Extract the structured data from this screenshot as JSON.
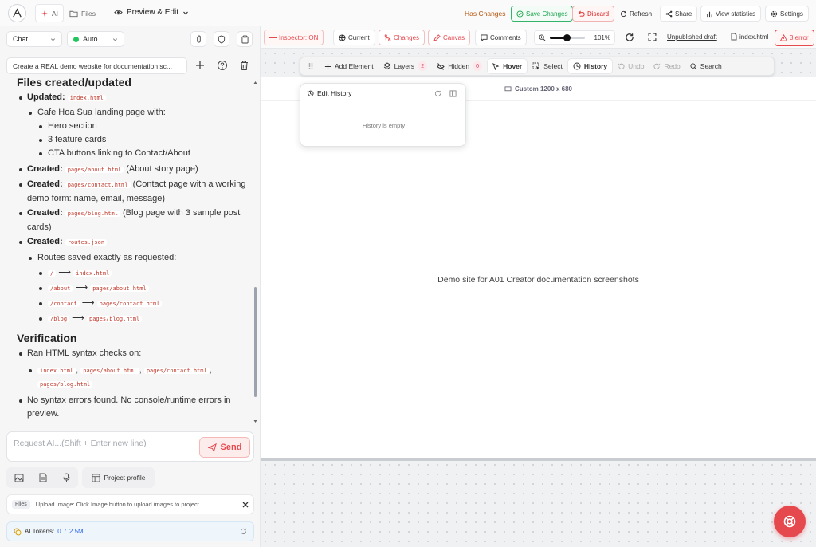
{
  "topbar": {
    "tabs": [
      {
        "label": "AI"
      },
      {
        "label": "Files"
      }
    ],
    "mode": "Preview & Edit",
    "status": "Has Changes",
    "save": "Save Changes",
    "discard": "Discard",
    "refresh": "Refresh",
    "share": "Share",
    "stats": "View statistics",
    "settings": "Settings"
  },
  "sidebar": {
    "mode_select": "Chat",
    "model_select": "Auto",
    "conversation_title": "Create a REAL demo website for documentation sc...",
    "message": {
      "h1": "Files created/updated",
      "updated_label": "Updated:",
      "updated_file": "index.html",
      "landing": "Cafe Hoa Sua landing page with:",
      "landing_items": [
        "Hero section",
        "3 feature cards",
        "CTA buttons linking to Contact/About"
      ],
      "created": [
        {
          "label": "Created:",
          "file": "pages/about.html",
          "desc": "(About story page)"
        },
        {
          "label": "Created:",
          "file": "pages/contact.html",
          "desc": "(Contact page with a working demo form: name, email, message)"
        },
        {
          "label": "Created:",
          "file": "pages/blog.html",
          "desc": "(Blog page with 3 sample post cards)"
        },
        {
          "label": "Created:",
          "file": "routes.json",
          "desc": ""
        }
      ],
      "routes_intro": "Routes saved exactly as requested:",
      "routes": [
        {
          "path": "/",
          "file": "index.html"
        },
        {
          "path": "/about",
          "file": "pages/about.html"
        },
        {
          "path": "/contact",
          "file": "pages/contact.html"
        },
        {
          "path": "/blog",
          "file": "pages/blog.html"
        }
      ],
      "arrow": "⟶",
      "h2": "Verification",
      "syntax": "Ran HTML syntax checks on:",
      "checked": [
        "index.html",
        "pages/about.html",
        "pages/contact.html",
        "pages/blog.html"
      ],
      "separator": ",",
      "result": "No syntax errors found. No console/runtime errors in preview."
    },
    "input_placeholder": "Request AI...(Shift + Enter new line)",
    "send": "Send",
    "project_profile": "Project profile",
    "files_tag": "Files",
    "upload_hint": "Upload Image: Click Image button to upload images to project.",
    "tokens_label": "AI Tokens:",
    "tokens_used": "0",
    "tokens_sep": "/",
    "tokens_total": "2.5M"
  },
  "canvas_toolbar": {
    "inspector": "Inspector: ON",
    "current": "Current",
    "changes": "Changes",
    "canvas": "Canvas",
    "comments": "Comments",
    "zoom": "101%",
    "zoom_value": 0.48,
    "unpublished": "Unpublished draft",
    "file": "index.html",
    "errors": "3 error"
  },
  "floating_toolbar": {
    "add_element": "Add Element",
    "layers": "Layers",
    "layers_count": "2",
    "hidden": "Hidden",
    "hidden_count": "0",
    "hover": "Hover",
    "select": "Select",
    "history": "History",
    "undo": "Undo",
    "redo": "Redo",
    "search": "Search"
  },
  "history_panel": {
    "title": "Edit History",
    "empty": "History is empty"
  },
  "preview": {
    "viewport": "Custom 1200 x 680",
    "text": "Demo site for A01 Creator documentation screenshots"
  },
  "colors": {
    "accent": "#e5484d",
    "green": "#16a34a",
    "amber": "#b45309"
  }
}
